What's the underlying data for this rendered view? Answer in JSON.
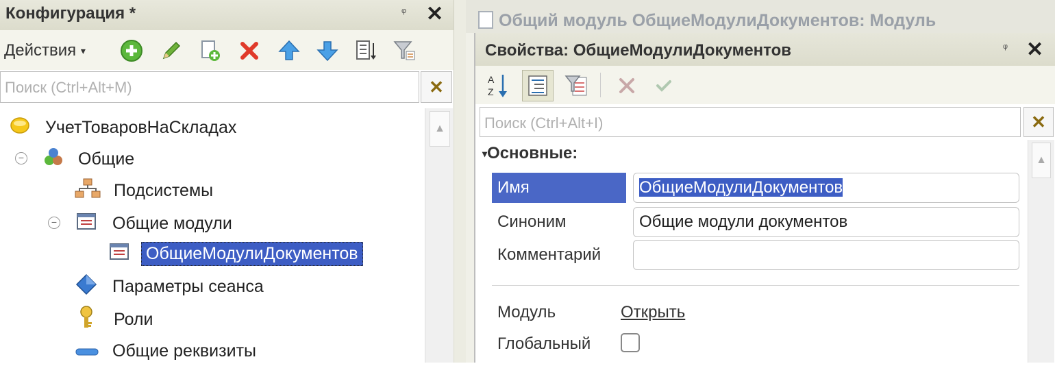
{
  "config_panel": {
    "title": "Конфигурация *",
    "pin": "ᵠ",
    "close": "✕",
    "actions_label": "Действия",
    "search_placeholder": "Поиск (Ctrl+Alt+M)",
    "search_clear": "✕",
    "tree": [
      {
        "label": "УчетТоваровНаСкладах",
        "icon": "configuration-icon"
      },
      {
        "label": "Общие",
        "icon": "common-group-icon",
        "toggle": "−"
      },
      {
        "label": "Подсистемы",
        "icon": "subsystems-icon"
      },
      {
        "label": "Общие модули",
        "icon": "common-module-icon",
        "toggle": "−"
      },
      {
        "label": "ОбщиеМодулиДокументов",
        "icon": "module-icon",
        "selected": true
      },
      {
        "label": "Параметры сеанса",
        "icon": "session-params-icon"
      },
      {
        "label": "Роли",
        "icon": "key-icon"
      },
      {
        "label": "Общие реквизиты",
        "icon": "attribute-icon"
      }
    ]
  },
  "background_tab": {
    "title": "Общий модуль ОбщиеМодулиДокументов: Модуль"
  },
  "properties_panel": {
    "title": "Свойства: ОбщиеМодулиДокументов",
    "pin": "ᵠ",
    "close": "✕",
    "search_placeholder": "Поиск (Ctrl+Alt+I)",
    "search_clear": "✕",
    "section": "Основные:",
    "fields": {
      "name_label": "Имя",
      "name_value": "ОбщиеМодулиДокументов",
      "synonym_label": "Синоним",
      "synonym_value": "Общие модули документов",
      "comment_label": "Комментарий",
      "comment_value": ""
    },
    "module_label": "Модуль",
    "module_link": "Открыть",
    "global_label": "Глобальный",
    "global_checked": false
  }
}
